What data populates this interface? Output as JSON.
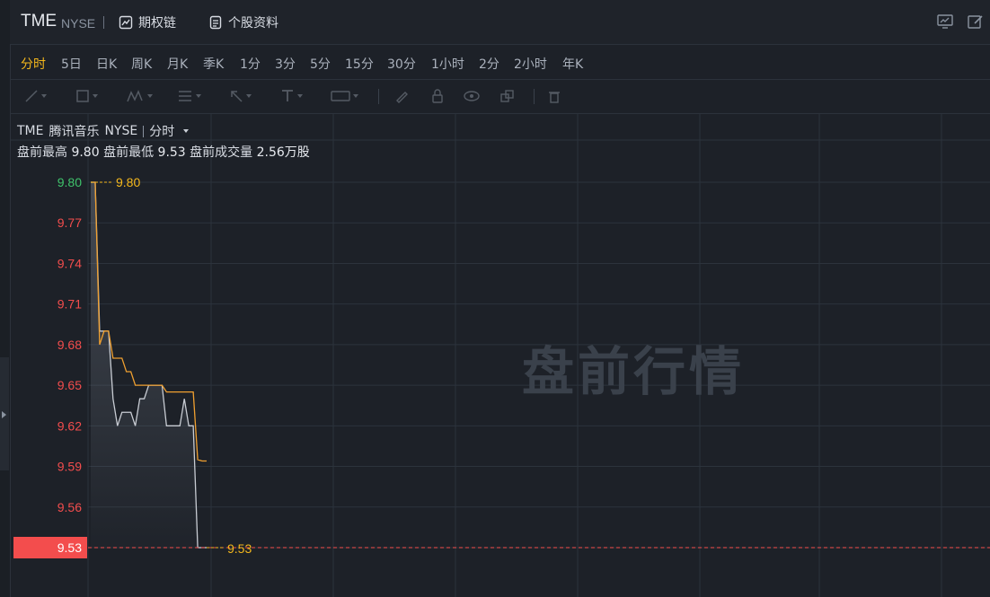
{
  "header": {
    "ticker": "TME",
    "exchange": "NYSE",
    "options_label": "期权链",
    "profile_label": "个股资料"
  },
  "periods": [
    {
      "label": "分时",
      "active": true
    },
    {
      "label": "5日"
    },
    {
      "label": "日K"
    },
    {
      "label": "周K"
    },
    {
      "label": "月K"
    },
    {
      "label": "季K"
    },
    {
      "label": "1分"
    },
    {
      "label": "3分"
    },
    {
      "label": "5分"
    },
    {
      "label": "15分"
    },
    {
      "label": "30分"
    },
    {
      "label": "1小时"
    },
    {
      "label": "2分"
    },
    {
      "label": "2小时"
    },
    {
      "label": "年K"
    }
  ],
  "legend": {
    "ticker": "TME",
    "name": "腾讯音乐",
    "exchange": "NYSE",
    "mode": "分时",
    "high_label": "盘前最高",
    "high_value": "9.80",
    "low_label": "盘前最低",
    "low_value": "9.53",
    "volume_label": "盘前成交量",
    "volume_value": "2.56万股"
  },
  "watermark": "盘前行情",
  "chart_data": {
    "type": "line",
    "ylim": [
      9.53,
      9.8
    ],
    "y_ticks": [
      "9.80",
      "9.77",
      "9.74",
      "9.71",
      "9.68",
      "9.65",
      "9.62",
      "9.59",
      "9.56",
      "9.53"
    ],
    "high_marker": "9.80",
    "low_marker": "9.53",
    "current_price": "9.53",
    "series": [
      {
        "color": "#c8ccd3",
        "values": [
          9.8,
          9.8,
          9.69,
          9.69,
          9.69,
          9.64,
          9.62,
          9.63,
          9.63,
          9.63,
          9.62,
          9.64,
          9.64,
          9.65,
          9.65,
          9.65,
          9.65,
          9.62,
          9.62,
          9.62,
          9.62,
          9.64,
          9.62,
          9.62,
          9.53,
          9.53,
          9.53
        ]
      },
      {
        "color": "#f0a030",
        "values": [
          9.8,
          9.8,
          9.68,
          9.69,
          9.69,
          9.67,
          9.67,
          9.67,
          9.66,
          9.66,
          9.65,
          9.65,
          9.65,
          9.65,
          9.65,
          9.65,
          9.65,
          9.645,
          9.645,
          9.645,
          9.645,
          9.645,
          9.645,
          9.645,
          9.595,
          9.594,
          9.594
        ]
      }
    ],
    "colors": {
      "up": "#3fc36b",
      "down": "#f34d4d",
      "axis_tick": "#f34d4d",
      "grid": "#2c333c"
    }
  }
}
